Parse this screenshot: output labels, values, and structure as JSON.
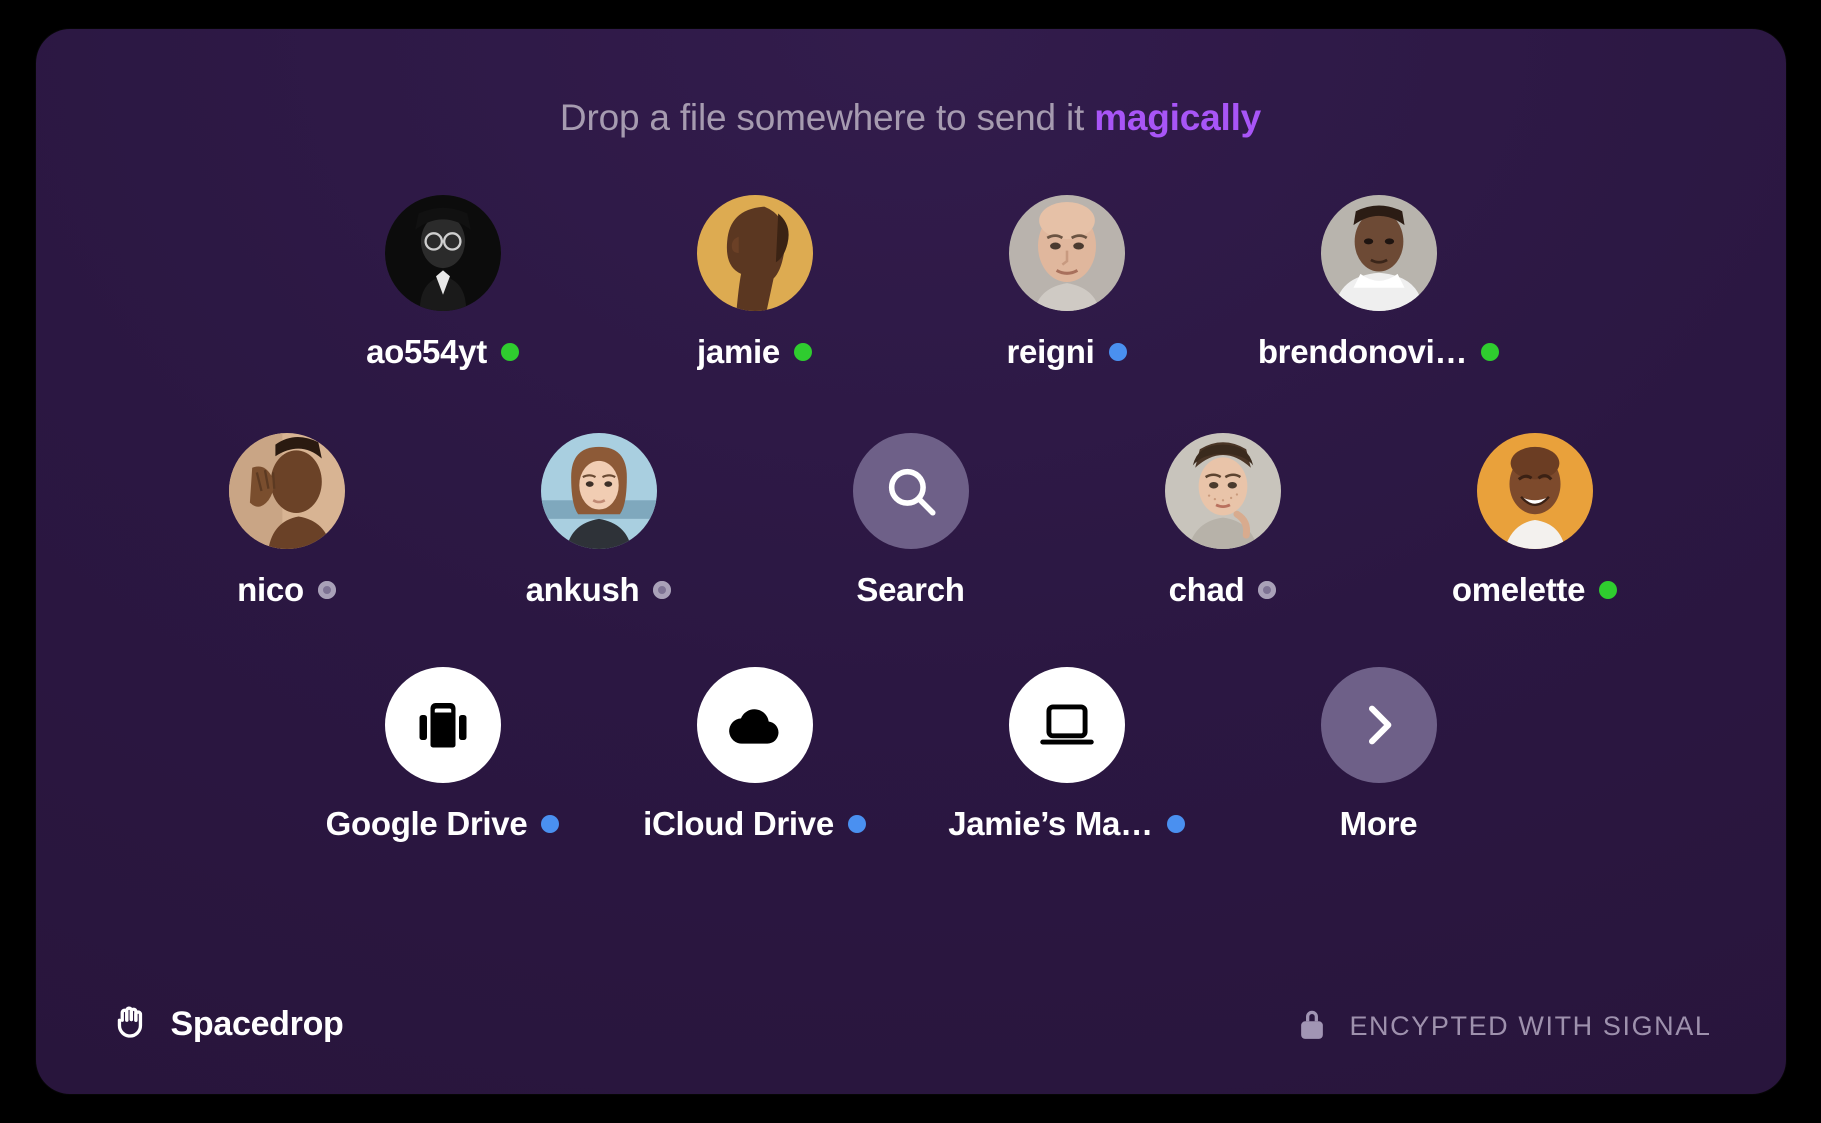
{
  "header": {
    "text_plain": "Drop a file somewhere to send it ",
    "text_accent": "magically",
    "accent_color": "#a855f7"
  },
  "colors": {
    "panel_bg": "#2b1742",
    "online": "#2fcc2f",
    "blue": "#4a90f0",
    "offline": "#7e7394",
    "muted_circle": "#6e6088",
    "white_circle": "#ffffff"
  },
  "rows": [
    {
      "items": [
        {
          "label": "ao554yt",
          "status": "online",
          "kind": "avatar",
          "avatar": "portrait-bw-glasses"
        },
        {
          "label": "jamie",
          "status": "online",
          "kind": "avatar",
          "avatar": "portrait-yellow-profile"
        },
        {
          "label": "reigni",
          "status": "blue",
          "kind": "avatar",
          "avatar": "portrait-bald-man"
        },
        {
          "label": "brendonovi…",
          "status": "online",
          "kind": "avatar",
          "avatar": "portrait-hoodie"
        }
      ]
    },
    {
      "items": [
        {
          "label": "nico",
          "status": "offline",
          "kind": "avatar",
          "avatar": "portrait-hand-face"
        },
        {
          "label": "ankush",
          "status": "offline",
          "kind": "avatar",
          "avatar": "portrait-bob-haircut"
        },
        {
          "label": "Search",
          "status": "none",
          "kind": "action",
          "icon": "search-icon"
        },
        {
          "label": "chad",
          "status": "offline",
          "kind": "avatar",
          "avatar": "portrait-freckles"
        },
        {
          "label": "omelette",
          "status": "online",
          "kind": "avatar",
          "avatar": "portrait-laughing-orange"
        }
      ]
    },
    {
      "items": [
        {
          "label": "Google Drive",
          "status": "blue",
          "kind": "service",
          "icon": "briefcase-icon"
        },
        {
          "label": "iCloud Drive",
          "status": "blue",
          "kind": "service",
          "icon": "cloud-icon"
        },
        {
          "label": "Jamie’s Ma…",
          "status": "blue",
          "kind": "service",
          "icon": "laptop-icon"
        },
        {
          "label": "More",
          "status": "none",
          "kind": "action",
          "icon": "chevron-right-icon"
        }
      ]
    }
  ],
  "footer": {
    "brand_name": "Spacedrop",
    "brand_icon": "hand-icon",
    "encrypted_text": "ENCYPTED WITH SIGNAL",
    "lock_icon": "lock-icon"
  }
}
